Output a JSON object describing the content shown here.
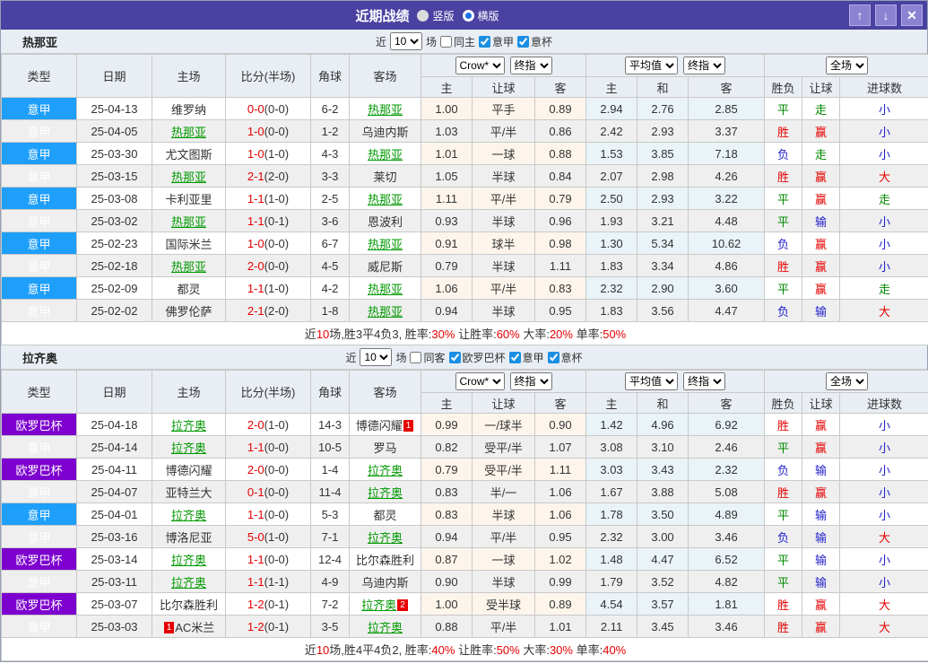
{
  "titlebar": {
    "title": "近期战绩",
    "layout_options": {
      "portrait": "竖版",
      "landscape": "横版",
      "selected": "横版"
    },
    "buttons": {
      "up": "↑",
      "down": "↓",
      "close": "✕"
    }
  },
  "dropdowns": {
    "company": "Crow*",
    "final_odds": "终指",
    "average": "平均值",
    "final_odds_2": "终指",
    "full_match": "全场"
  },
  "columns": {
    "type": "类型",
    "date": "日期",
    "home": "主场",
    "score": "比分(半场)",
    "corner": "角球",
    "away": "客场",
    "odds_home": "主",
    "odds_handicap": "让球",
    "odds_away": "客",
    "avg_home": "主",
    "avg_draw": "和",
    "avg_away": "客",
    "res_wdl": "胜负",
    "res_handicap": "让球",
    "res_goals": "进球数"
  },
  "colors": {
    "titlebar": "#4a41a1",
    "serie_a_badge": "#1e9ffa",
    "europa_badge": "#7d00cf",
    "team_link_green": "#009900",
    "score_red": "#e60000",
    "result_red": "#e60000",
    "result_green": "#008800",
    "result_blue": "#2222cc",
    "handicap_col_bg": "#fdf5ec",
    "average_col_bg": "#e9f3f8",
    "checkbox_blue": "#1a8fe3"
  },
  "sections": [
    {
      "team": "热那亚",
      "filter": {
        "near": "近",
        "count": "10",
        "unit": "场",
        "checks": [
          {
            "label": "同主",
            "checked": false
          },
          {
            "label": "意甲",
            "checked": true
          },
          {
            "label": "意杯",
            "checked": true
          }
        ]
      },
      "rows": [
        {
          "comp": "意甲",
          "comp_color": "blue",
          "date": "25-04-13",
          "home": {
            "name": "维罗纳",
            "team": false
          },
          "score": "0-0",
          "half": "(0-0)",
          "corner": "6-2",
          "away": {
            "name": "热那亚",
            "team": true
          },
          "odds": [
            "1.00",
            "平手",
            "0.89"
          ],
          "avg": [
            "2.94",
            "2.76",
            "2.85"
          ],
          "res": [
            [
              "平",
              "g"
            ],
            [
              "走",
              "g"
            ],
            [
              "小",
              "b"
            ]
          ]
        },
        {
          "comp": "意甲",
          "comp_color": "blue",
          "date": "25-04-05",
          "home": {
            "name": "热那亚",
            "team": true
          },
          "score": "1-0",
          "half": "(0-0)",
          "corner": "1-2",
          "away": {
            "name": "乌迪内斯",
            "team": false
          },
          "odds": [
            "1.03",
            "平/半",
            "0.86"
          ],
          "avg": [
            "2.42",
            "2.93",
            "3.37"
          ],
          "res": [
            [
              "胜",
              "r"
            ],
            [
              "赢",
              "r"
            ],
            [
              "小",
              "b"
            ]
          ]
        },
        {
          "comp": "意甲",
          "comp_color": "blue",
          "date": "25-03-30",
          "home": {
            "name": "尤文图斯",
            "team": false
          },
          "score": "1-0",
          "half": "(1-0)",
          "corner": "4-3",
          "away": {
            "name": "热那亚",
            "team": true
          },
          "odds": [
            "1.01",
            "一球",
            "0.88"
          ],
          "avg": [
            "1.53",
            "3.85",
            "7.18"
          ],
          "res": [
            [
              "负",
              "b"
            ],
            [
              "走",
              "g"
            ],
            [
              "小",
              "b"
            ]
          ]
        },
        {
          "comp": "意甲",
          "comp_color": "blue",
          "date": "25-03-15",
          "home": {
            "name": "热那亚",
            "team": true
          },
          "score": "2-1",
          "half": "(2-0)",
          "corner": "3-3",
          "away": {
            "name": "莱切",
            "team": false
          },
          "odds": [
            "1.05",
            "半球",
            "0.84"
          ],
          "avg": [
            "2.07",
            "2.98",
            "4.26"
          ],
          "res": [
            [
              "胜",
              "r"
            ],
            [
              "赢",
              "r"
            ],
            [
              "大",
              "r"
            ]
          ]
        },
        {
          "comp": "意甲",
          "comp_color": "blue",
          "date": "25-03-08",
          "home": {
            "name": "卡利亚里",
            "team": false
          },
          "score": "1-1",
          "half": "(1-0)",
          "corner": "2-5",
          "away": {
            "name": "热那亚",
            "team": true
          },
          "odds": [
            "1.11",
            "平/半",
            "0.79"
          ],
          "avg": [
            "2.50",
            "2.93",
            "3.22"
          ],
          "res": [
            [
              "平",
              "g"
            ],
            [
              "赢",
              "r"
            ],
            [
              "走",
              "g"
            ]
          ]
        },
        {
          "comp": "意甲",
          "comp_color": "blue",
          "date": "25-03-02",
          "home": {
            "name": "热那亚",
            "team": true
          },
          "score": "1-1",
          "half": "(0-1)",
          "corner": "3-6",
          "away": {
            "name": "恩波利",
            "team": false
          },
          "odds": [
            "0.93",
            "半球",
            "0.96"
          ],
          "avg": [
            "1.93",
            "3.21",
            "4.48"
          ],
          "res": [
            [
              "平",
              "g"
            ],
            [
              "输",
              "b"
            ],
            [
              "小",
              "b"
            ]
          ]
        },
        {
          "comp": "意甲",
          "comp_color": "blue",
          "date": "25-02-23",
          "home": {
            "name": "国际米兰",
            "team": false
          },
          "score": "1-0",
          "half": "(0-0)",
          "corner": "6-7",
          "away": {
            "name": "热那亚",
            "team": true
          },
          "odds": [
            "0.91",
            "球半",
            "0.98"
          ],
          "avg": [
            "1.30",
            "5.34",
            "10.62"
          ],
          "res": [
            [
              "负",
              "b"
            ],
            [
              "赢",
              "r"
            ],
            [
              "小",
              "b"
            ]
          ]
        },
        {
          "comp": "意甲",
          "comp_color": "blue",
          "date": "25-02-18",
          "home": {
            "name": "热那亚",
            "team": true
          },
          "score": "2-0",
          "half": "(0-0)",
          "corner": "4-5",
          "away": {
            "name": "威尼斯",
            "team": false
          },
          "odds": [
            "0.79",
            "半球",
            "1.11"
          ],
          "avg": [
            "1.83",
            "3.34",
            "4.86"
          ],
          "res": [
            [
              "胜",
              "r"
            ],
            [
              "赢",
              "r"
            ],
            [
              "小",
              "b"
            ]
          ]
        },
        {
          "comp": "意甲",
          "comp_color": "blue",
          "date": "25-02-09",
          "home": {
            "name": "都灵",
            "team": false
          },
          "score": "1-1",
          "half": "(1-0)",
          "corner": "4-2",
          "away": {
            "name": "热那亚",
            "team": true
          },
          "odds": [
            "1.06",
            "平/半",
            "0.83"
          ],
          "avg": [
            "2.32",
            "2.90",
            "3.60"
          ],
          "res": [
            [
              "平",
              "g"
            ],
            [
              "赢",
              "r"
            ],
            [
              "走",
              "g"
            ]
          ]
        },
        {
          "comp": "意甲",
          "comp_color": "blue",
          "date": "25-02-02",
          "home": {
            "name": "佛罗伦萨",
            "team": false
          },
          "score": "2-1",
          "half": "(2-0)",
          "corner": "1-8",
          "away": {
            "name": "热那亚",
            "team": true
          },
          "odds": [
            "0.94",
            "半球",
            "0.95"
          ],
          "avg": [
            "1.83",
            "3.56",
            "4.47"
          ],
          "res": [
            [
              "负",
              "b"
            ],
            [
              "输",
              "b"
            ],
            [
              "大",
              "r"
            ]
          ]
        }
      ],
      "summary": [
        [
          "近",
          0
        ],
        [
          "10",
          1
        ],
        [
          "场,胜3平4负3, 胜率:",
          0
        ],
        [
          "30%",
          1
        ],
        [
          " 让胜率:",
          0
        ],
        [
          "60%",
          1
        ],
        [
          " 大率:",
          0
        ],
        [
          "20%",
          1
        ],
        [
          " 单率:",
          0
        ],
        [
          "50%",
          1
        ]
      ]
    },
    {
      "team": "拉齐奥",
      "filter": {
        "near": "近",
        "count": "10",
        "unit": "场",
        "checks": [
          {
            "label": "同客",
            "checked": false
          },
          {
            "label": "欧罗巴杯",
            "checked": true
          },
          {
            "label": "意甲",
            "checked": true
          },
          {
            "label": "意杯",
            "checked": true
          }
        ]
      },
      "rows": [
        {
          "comp": "欧罗巴杯",
          "comp_color": "purple",
          "date": "25-04-18",
          "home": {
            "name": "拉齐奥",
            "team": true
          },
          "score": "2-0",
          "half": "(1-0)",
          "corner": "14-3",
          "away": {
            "name": "博德闪耀",
            "team": false,
            "badge": "1"
          },
          "odds": [
            "0.99",
            "一/球半",
            "0.90"
          ],
          "avg": [
            "1.42",
            "4.96",
            "6.92"
          ],
          "res": [
            [
              "胜",
              "r"
            ],
            [
              "赢",
              "r"
            ],
            [
              "小",
              "b"
            ]
          ]
        },
        {
          "comp": "意甲",
          "comp_color": "blue",
          "date": "25-04-14",
          "home": {
            "name": "拉齐奥",
            "team": true
          },
          "score": "1-1",
          "half": "(0-0)",
          "corner": "10-5",
          "away": {
            "name": "罗马",
            "team": false
          },
          "odds": [
            "0.82",
            "受平/半",
            "1.07"
          ],
          "avg": [
            "3.08",
            "3.10",
            "2.46"
          ],
          "res": [
            [
              "平",
              "g"
            ],
            [
              "赢",
              "r"
            ],
            [
              "小",
              "b"
            ]
          ]
        },
        {
          "comp": "欧罗巴杯",
          "comp_color": "purple",
          "date": "25-04-11",
          "home": {
            "name": "博德闪耀",
            "team": false
          },
          "score": "2-0",
          "half": "(0-0)",
          "corner": "1-4",
          "away": {
            "name": "拉齐奥",
            "team": true
          },
          "odds": [
            "0.79",
            "受平/半",
            "1.11"
          ],
          "avg": [
            "3.03",
            "3.43",
            "2.32"
          ],
          "res": [
            [
              "负",
              "b"
            ],
            [
              "输",
              "b"
            ],
            [
              "小",
              "b"
            ]
          ]
        },
        {
          "comp": "意甲",
          "comp_color": "blue",
          "date": "25-04-07",
          "home": {
            "name": "亚特兰大",
            "team": false
          },
          "score": "0-1",
          "half": "(0-0)",
          "corner": "11-4",
          "away": {
            "name": "拉齐奥",
            "team": true
          },
          "odds": [
            "0.83",
            "半/一",
            "1.06"
          ],
          "avg": [
            "1.67",
            "3.88",
            "5.08"
          ],
          "res": [
            [
              "胜",
              "r"
            ],
            [
              "赢",
              "r"
            ],
            [
              "小",
              "b"
            ]
          ]
        },
        {
          "comp": "意甲",
          "comp_color": "blue",
          "date": "25-04-01",
          "home": {
            "name": "拉齐奥",
            "team": true
          },
          "score": "1-1",
          "half": "(0-0)",
          "corner": "5-3",
          "away": {
            "name": "都灵",
            "team": false
          },
          "odds": [
            "0.83",
            "半球",
            "1.06"
          ],
          "avg": [
            "1.78",
            "3.50",
            "4.89"
          ],
          "res": [
            [
              "平",
              "g"
            ],
            [
              "输",
              "b"
            ],
            [
              "小",
              "b"
            ]
          ]
        },
        {
          "comp": "意甲",
          "comp_color": "blue",
          "date": "25-03-16",
          "home": {
            "name": "博洛尼亚",
            "team": false
          },
          "score": "5-0",
          "half": "(1-0)",
          "corner": "7-1",
          "away": {
            "name": "拉齐奥",
            "team": true
          },
          "odds": [
            "0.94",
            "平/半",
            "0.95"
          ],
          "avg": [
            "2.32",
            "3.00",
            "3.46"
          ],
          "res": [
            [
              "负",
              "b"
            ],
            [
              "输",
              "b"
            ],
            [
              "大",
              "r"
            ]
          ]
        },
        {
          "comp": "欧罗巴杯",
          "comp_color": "purple",
          "date": "25-03-14",
          "home": {
            "name": "拉齐奥",
            "team": true
          },
          "score": "1-1",
          "half": "(0-0)",
          "corner": "12-4",
          "away": {
            "name": "比尔森胜利",
            "team": false
          },
          "odds": [
            "0.87",
            "一球",
            "1.02"
          ],
          "avg": [
            "1.48",
            "4.47",
            "6.52"
          ],
          "res": [
            [
              "平",
              "g"
            ],
            [
              "输",
              "b"
            ],
            [
              "小",
              "b"
            ]
          ]
        },
        {
          "comp": "意甲",
          "comp_color": "blue",
          "date": "25-03-11",
          "home": {
            "name": "拉齐奥",
            "team": true
          },
          "score": "1-1",
          "half": "(1-1)",
          "corner": "4-9",
          "away": {
            "name": "乌迪内斯",
            "team": false
          },
          "odds": [
            "0.90",
            "半球",
            "0.99"
          ],
          "avg": [
            "1.79",
            "3.52",
            "4.82"
          ],
          "res": [
            [
              "平",
              "g"
            ],
            [
              "输",
              "b"
            ],
            [
              "小",
              "b"
            ]
          ]
        },
        {
          "comp": "欧罗巴杯",
          "comp_color": "purple",
          "date": "25-03-07",
          "home": {
            "name": "比尔森胜利",
            "team": false
          },
          "score": "1-2",
          "half": "(0-1)",
          "corner": "7-2",
          "away": {
            "name": "拉齐奥",
            "team": true,
            "badge": "2"
          },
          "odds": [
            "1.00",
            "受半球",
            "0.89"
          ],
          "avg": [
            "4.54",
            "3.57",
            "1.81"
          ],
          "res": [
            [
              "胜",
              "r"
            ],
            [
              "赢",
              "r"
            ],
            [
              "大",
              "r"
            ]
          ]
        },
        {
          "comp": "意甲",
          "comp_color": "blue",
          "date": "25-03-03",
          "home": {
            "name": "AC米兰",
            "team": false,
            "badge": "1",
            "badge_pos": "before"
          },
          "score": "1-2",
          "half": "(0-1)",
          "corner": "3-5",
          "away": {
            "name": "拉齐奥",
            "team": true
          },
          "odds": [
            "0.88",
            "平/半",
            "1.01"
          ],
          "avg": [
            "2.11",
            "3.45",
            "3.46"
          ],
          "res": [
            [
              "胜",
              "r"
            ],
            [
              "赢",
              "r"
            ],
            [
              "大",
              "r"
            ]
          ]
        }
      ],
      "summary": [
        [
          "近",
          0
        ],
        [
          "10",
          1
        ],
        [
          "场,胜4平4负2, 胜率:",
          0
        ],
        [
          "40%",
          1
        ],
        [
          " 让胜率:",
          0
        ],
        [
          "50%",
          1
        ],
        [
          " 大率:",
          0
        ],
        [
          "30%",
          1
        ],
        [
          " 单率:",
          0
        ],
        [
          "40%",
          1
        ]
      ]
    }
  ]
}
